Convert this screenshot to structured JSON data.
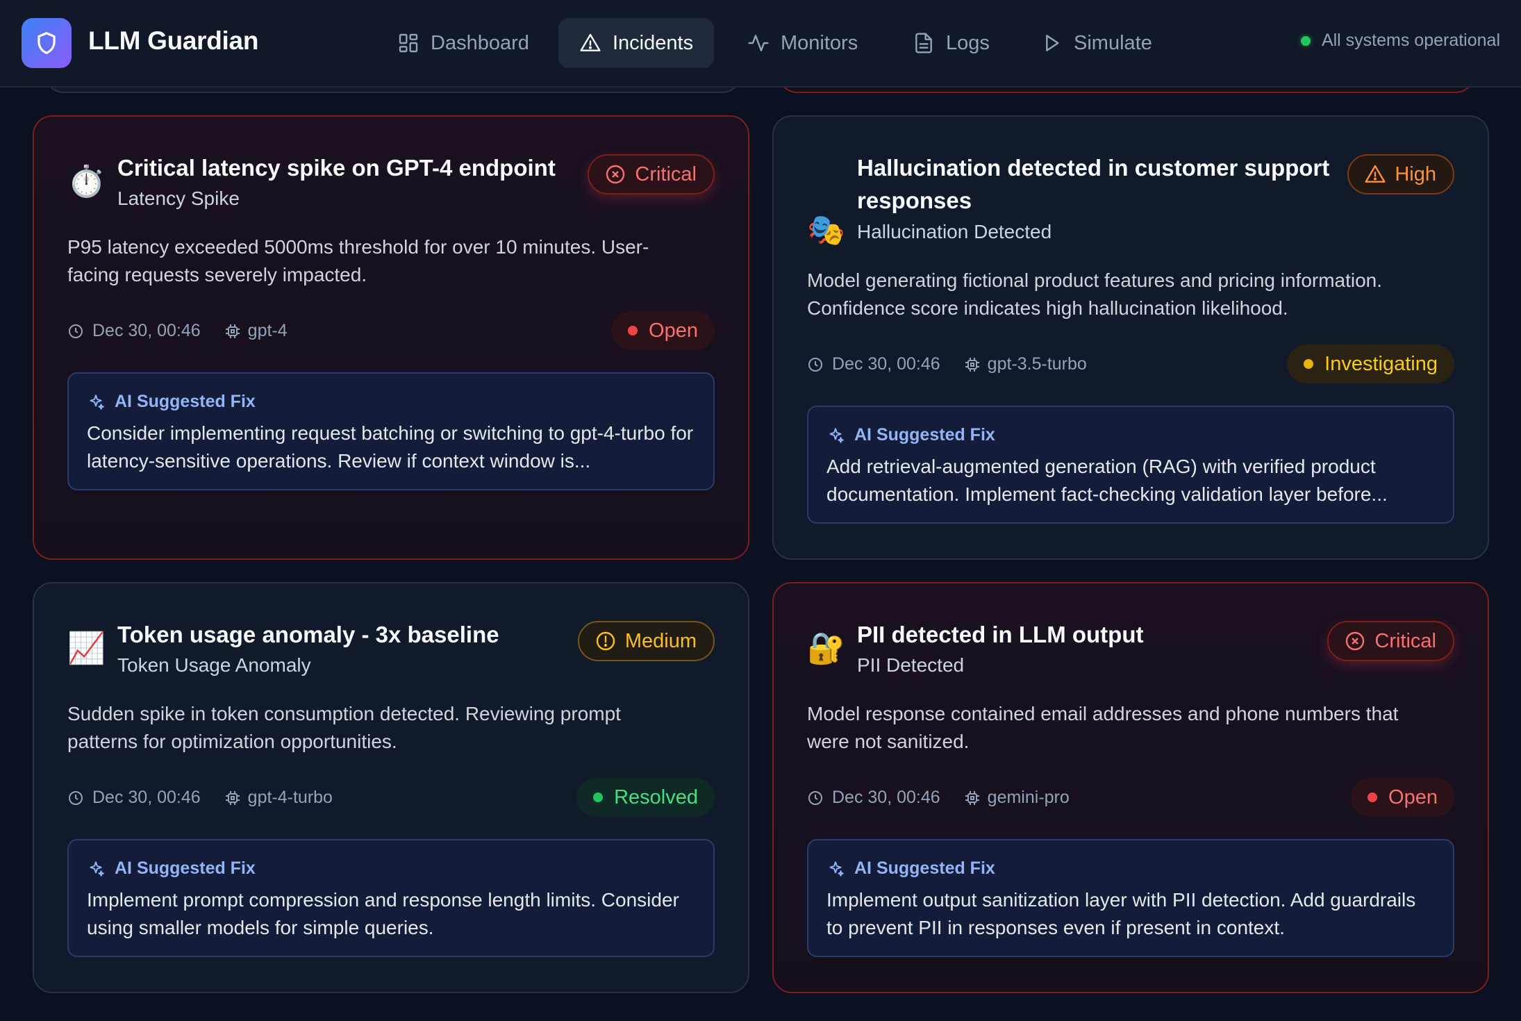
{
  "app": {
    "title": "LLM Guardian"
  },
  "nav": [
    {
      "label": "Dashboard"
    },
    {
      "label": "Incidents"
    },
    {
      "label": "Monitors"
    },
    {
      "label": "Logs"
    },
    {
      "label": "Simulate"
    }
  ],
  "status": {
    "text": "All systems operational",
    "color": "#22c55e"
  },
  "fix_heading": "AI Suggested Fix",
  "incidents": [
    {
      "emoji": "⏱️",
      "title": "Critical latency spike on GPT-4 endpoint",
      "category": "Latency Spike",
      "severity": "Critical",
      "description": "P95 latency exceeded 5000ms threshold for over 10 minutes. User-facing requests severely impacted.",
      "time": "Dec 30, 00:46",
      "model": "gpt-4",
      "state": "Open",
      "fix": "Consider implementing request batching or switching to gpt-4-turbo for latency-sensitive operations. Review if context window is..."
    },
    {
      "emoji": "🎭",
      "title": "Hallucination detected in customer support responses",
      "category": "Hallucination Detected",
      "severity": "High",
      "description": "Model generating fictional product features and pricing information. Confidence score indicates high hallucination likelihood.",
      "time": "Dec 30, 00:46",
      "model": "gpt-3.5-turbo",
      "state": "Investigating",
      "fix": "Add retrieval-augmented generation (RAG) with verified product documentation. Implement fact-checking validation layer before..."
    },
    {
      "emoji": "📈",
      "title": "Token usage anomaly - 3x baseline",
      "category": "Token Usage Anomaly",
      "severity": "Medium",
      "description": "Sudden spike in token consumption detected. Reviewing prompt patterns for optimization opportunities.",
      "time": "Dec 30, 00:46",
      "model": "gpt-4-turbo",
      "state": "Resolved",
      "fix": "Implement prompt compression and response length limits. Consider using smaller models for simple queries."
    },
    {
      "emoji": "🔐",
      "title": "PII detected in LLM output",
      "category": "PII Detected",
      "severity": "Critical",
      "description": "Model response contained email addresses and phone numbers that were not sanitized.",
      "time": "Dec 30, 00:46",
      "model": "gemini-pro",
      "state": "Open",
      "fix": "Implement output sanitization layer with PII detection. Add guardrails to prevent PII in responses even if present in context."
    }
  ]
}
